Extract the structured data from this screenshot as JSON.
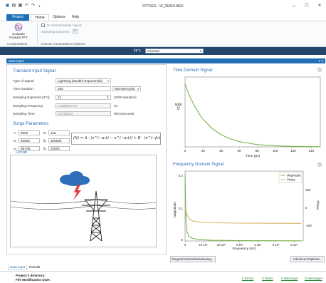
{
  "window": {
    "title": "FFTSES - W_DEMO.BES",
    "toolbar_icons": [
      "app-icon",
      "save-icon",
      "print-icon",
      "undo-icon",
      "redo-icon",
      "dropdown-icon"
    ],
    "minimize": "–",
    "maximize": "☐",
    "close": "✕"
  },
  "ribbon": {
    "tabs": [
      "Project",
      "Home",
      "Options",
      "Help"
    ],
    "compute_button": "Compute Forward FFT",
    "do_not_modulate": "Do Not Modulate Signal",
    "sampling_exponent_label": "Sampling Exponent",
    "sampling_exponent_value": "9",
    "group_computations": "Computations",
    "group_inverse": "Inverse Computations Options"
  },
  "fft": {
    "label": "FFT:",
    "selected": "Forward"
  },
  "panel": {
    "header": "Data Input",
    "controls": "▾ ✕"
  },
  "transient": {
    "title": "Transient Input Signal",
    "type_label": "Type of Signal:",
    "type_value": "Lightning (Double-Exponential)",
    "duration_label": "Time Duration:",
    "duration_value": "160",
    "duration_unit": "Microseconds",
    "exp_label": "Sampling Exponent (2^n):",
    "exp_value": "11",
    "exp_samples": "(2048 samples)",
    "freq_label": "Sampling Frequency:",
    "freq_value": "1.28000E+07",
    "freq_unit": "Hz",
    "time_label": "Sampling Time:",
    "time_value": "0.0781622",
    "time_unit": "Microseconds"
  },
  "surge": {
    "title": "Surge Parameters",
    "A_label": "A",
    "A_value": "9000",
    "B_label": "B",
    "B_value": "115",
    "a1_label": "α₁",
    "a1_value": "40000",
    "b1_label": "β₁",
    "b1_value": "100000",
    "a2_label": "α₂",
    "a2_value": "3E+08",
    "b2_label": "β₂",
    "b2_value": "22000",
    "formula": "f(t) = A · (e^(−α₁t) − e^(−α₂t)) + B · (e^(−β₁t)"
  },
  "circuit": {
    "title": "Circuit"
  },
  "left_tabs": [
    "Data Input",
    "Results"
  ],
  "time_chart": {
    "title": "Time Domain Signal",
    "ylabel": "f(t)",
    "xlabel": "Time (μs)",
    "y_tick": "5000",
    "x_ticks": [
      "0",
      "20",
      "40",
      "60",
      "80",
      "100",
      "120",
      "140"
    ]
  },
  "freq_chart": {
    "title": "Frequency Domain Signal",
    "ylabel_left": "Magnitude",
    "ylabel_right": "Phase",
    "xlabel": "Frequency (Hz)",
    "y_ticks_left": [
      "0.2",
      "0.1",
      "0"
    ],
    "y_ticks_right": [
      "100",
      "0",
      "-100"
    ],
    "x_ticks": [
      "0",
      "10 10⁵",
      "20 10⁵",
      "3 10⁶",
      "4 10⁶",
      "5 10⁶",
      "6 10⁶"
    ],
    "legend": [
      "Magnitude",
      "Phase"
    ]
  },
  "buttons": {
    "regularization": "Regularizations/Windowing...",
    "advanced": "Advanced Options..."
  },
  "status": {
    "project_dir": "Project's directory:",
    "file_mod": "File Modification Date:",
    "errors": "0 Errors",
    "tasks": "0 Tasks",
    "warnings": "0 Warnings",
    "messages": "0 Messages"
  },
  "colors": {
    "accent": "#1f6fb5",
    "fft_bar": "#25466d",
    "title_blue": "#2a6fb3",
    "magnitude": "#6aa84f",
    "phase": "#d9b36a",
    "status_green": "#2f8a3c"
  },
  "chart_data": [
    {
      "type": "line",
      "title": "Time Domain Signal",
      "xlabel": "Time (μs)",
      "ylabel": "f(t)",
      "xlim": [
        0,
        150
      ],
      "ylim": [
        0,
        10000
      ],
      "series": [
        {
          "x": [
            0,
            2,
            5,
            10,
            15,
            20,
            30,
            40,
            50,
            60,
            80,
            100,
            120,
            140,
            150
          ],
          "y": [
            9000,
            8270,
            7300,
            5950,
            4850,
            3950,
            2620,
            1730,
            1150,
            760,
            330,
            145,
            65,
            30,
            20
          ]
        }
      ]
    },
    {
      "type": "line",
      "title": "Frequency Domain Signal",
      "xlabel": "Frequency (Hz)",
      "ylabel": "Magnitude",
      "xlim": [
        0,
        6500000
      ],
      "ylim": [
        0,
        0.22
      ],
      "series": [
        {
          "name": "Magnitude",
          "x": [
            0,
            50000,
            100000,
            200000,
            400000,
            800000,
            1500000,
            3000000,
            6400000
          ],
          "y": [
            0.21,
            0.06,
            0.03,
            0.015,
            0.008,
            0.004,
            0.002,
            0.001,
            0.0005
          ]
        },
        {
          "name": "Phase",
          "x": [
            0,
            100000,
            200000,
            400000,
            800000,
            1500000,
            3000000,
            6400000
          ],
          "y": [
            0,
            -40,
            -60,
            -75,
            -82,
            -86,
            -88,
            -89
          ]
        }
      ]
    }
  ]
}
